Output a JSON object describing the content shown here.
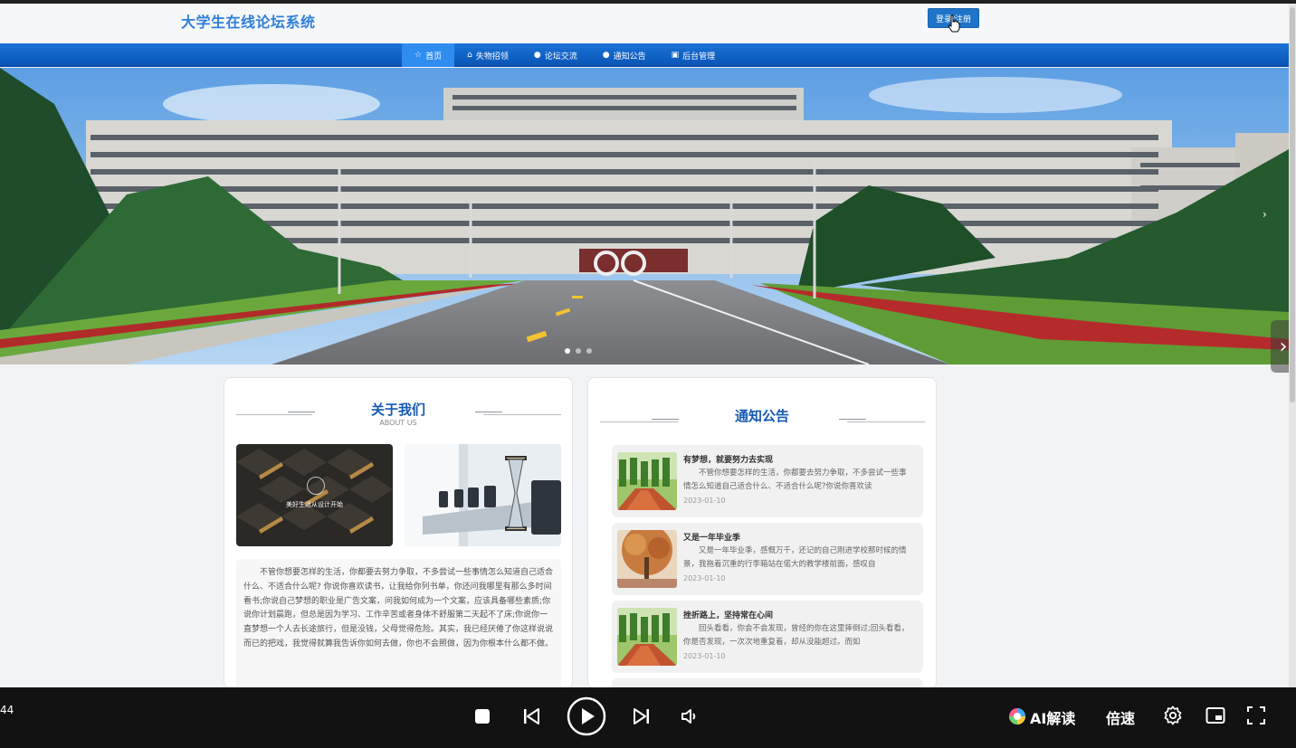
{
  "header": {
    "site_title": "大学生在线论坛系统",
    "login_label": "登录/注册"
  },
  "nav": {
    "items": [
      {
        "label": "首页",
        "icon": "star-icon",
        "active": true
      },
      {
        "label": "失物招领",
        "icon": "bag-icon",
        "active": false
      },
      {
        "label": "论坛交流",
        "icon": "info-icon",
        "active": false
      },
      {
        "label": "通知公告",
        "icon": "circle-icon",
        "active": false
      },
      {
        "label": "后台管理",
        "icon": "admin-icon",
        "active": false
      }
    ]
  },
  "banner": {
    "slide_count": 3,
    "active_slide": 1
  },
  "about": {
    "title": "关于我们",
    "subtitle": "ABOUT US",
    "image_caption": "美好生活从设计开始",
    "text": "不管你想要怎样的生活，你都要去努力争取，不多尝试一些事情怎么知道自己适合什么、不适合什么呢? 你说你喜欢读书，让我给你列书单，你还问我哪里有那么多时间看书;你说自己梦想的职业是广告文案，问我如何成为一个文案，应该具备哪些素质;你说你计划晨跑，但总是因为学习、工作辛苦或者身体不舒服第二天起不了床;你说你一直梦想一个人去长途旅行，但是没钱，父母觉得危险。其实，我已经厌倦了你这样说说而已的把戏，我觉得就算我告诉你如何去做，你也不会照做，因为你根本什么都不做。"
  },
  "notice": {
    "title": "通知公告",
    "items": [
      {
        "title": "有梦想，就要努力去实现",
        "desc": "不管你想要怎样的生活，你都要去努力争取，不多尝试一些事情怎么知道自己适合什么、不适合什么呢?你说你喜欢读",
        "date": "2023-01-10",
        "thumb": "track"
      },
      {
        "title": "又是一年毕业季",
        "desc": "又是一年毕业季，感慨万千，还记的自己刚进学校那时候的情景，我拖着沉重的行李箱站在偌大的教学楼前面，感叹自",
        "date": "2023-01-10",
        "thumb": "autumn"
      },
      {
        "title": "挫折路上，坚持常在心间",
        "desc": "回头看看，你会不会发现，曾经的你在这里摔倒过;回头看看，你是否发现，一次次地重复着，却从没能超过。而如",
        "date": "2023-01-10",
        "thumb": "track"
      }
    ]
  },
  "player": {
    "time": "44",
    "ai_label": "AI解读",
    "speed_label": "倍速"
  }
}
